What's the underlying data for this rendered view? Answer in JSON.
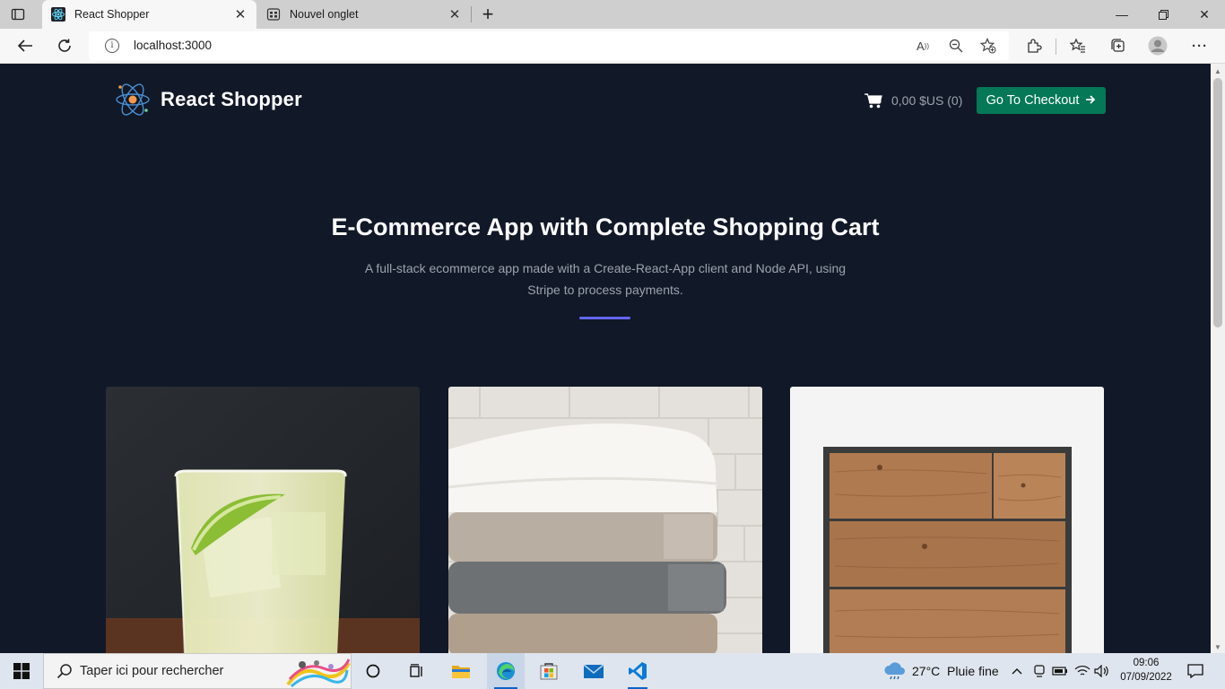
{
  "browser": {
    "tabs": [
      {
        "title": "React Shopper",
        "active": true
      },
      {
        "title": "Nouvel onglet",
        "active": false
      }
    ],
    "address": "localhost:3000"
  },
  "header": {
    "brand": "React Shopper",
    "cart_summary": "0,00 $US (0)",
    "checkout_label": "Go To Checkout",
    "accent": "#047857"
  },
  "hero": {
    "title": "E-Commerce App with Complete Shopping Cart",
    "subtitle": "A full-stack ecommerce app made with a Create-React-App client and Node API, using Stripe to process payments.",
    "rule_color": "#6366f1"
  },
  "products": [
    {
      "image": "lemonade-glass"
    },
    {
      "image": "folded-towels"
    },
    {
      "image": "wooden-dresser"
    }
  ],
  "taskbar": {
    "search_placeholder": "Taper ici pour rechercher",
    "weather": "27°C  Pluie fine",
    "time": "09:06",
    "date": "07/09/2022"
  }
}
